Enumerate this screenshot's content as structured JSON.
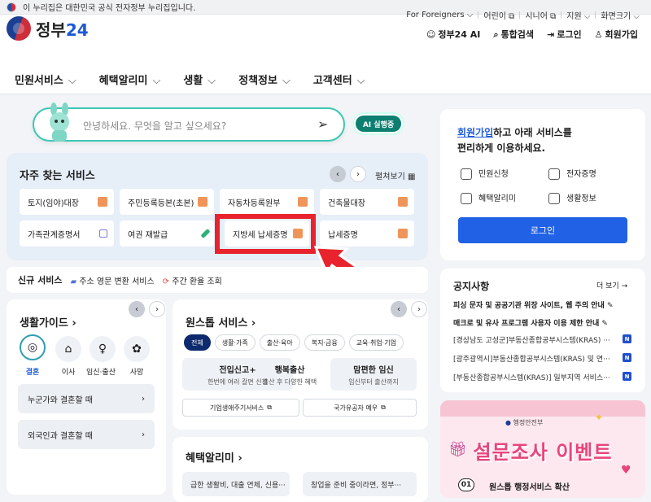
{
  "gov_banner": {
    "text": "이 누리집은 대한민국 공식 전자정부 누리집입니다."
  },
  "logo": {
    "text_main": "정부",
    "text_num": "24"
  },
  "util_links": [
    "For Foreigners",
    "어린이",
    "시니어",
    "지원",
    "화면크기"
  ],
  "util_actions": {
    "ai": "정부24 AI",
    "search": "통합검색",
    "login": "로그인",
    "signup": "회원가입"
  },
  "nav": [
    "민원서비스",
    "혜택알리미",
    "생활",
    "정책정보",
    "고객센터"
  ],
  "search": {
    "placeholder": "안녕하세요. 무엇을 알고 싶으세요?",
    "ai_badge": "AI 실행중"
  },
  "frequent": {
    "title": "자주 찾는 서비스",
    "expand": "펼쳐보기",
    "row1": [
      "토지(임야)대장",
      "주민등록등본(초본)",
      "자동차등록원부",
      "건축물대장"
    ],
    "row2": [
      "가족관계증명서",
      "여권 재발급",
      "지방세 납세증명",
      "납세증명"
    ]
  },
  "new_service": {
    "title": "신규 서비스",
    "items": [
      "주소 영문 변환 서비스",
      "주간 환율 조회"
    ]
  },
  "life_guide": {
    "title": "생활가이드",
    "categories": [
      "결혼",
      "이사",
      "임신·출산",
      "사망"
    ],
    "rows": [
      "누군가와 결혼할 때",
      "외국인과 결혼할 때"
    ]
  },
  "one_stop": {
    "title": "원스톱 서비스",
    "chips": [
      "전체",
      "생활·가족",
      "출산·육아",
      "복지·금융",
      "교육·취업·기업"
    ],
    "items": [
      {
        "title": "전입신고+",
        "sub": "한번에 여러 갈면 신청"
      },
      {
        "title": "행복출산",
        "sub": "출산 후 다양한 혜택"
      },
      {
        "title": "맘편한 임신",
        "sub": "임신부터 출산까지"
      }
    ],
    "links": [
      "기업생애주기서비스",
      "국가유공자 예우"
    ]
  },
  "benefit": {
    "title": "혜택알리미",
    "rows": [
      "급한 생활비, 대출 연체, 신용···",
      "창업을 준비 중이라면, 정부···"
    ]
  },
  "join_box": {
    "link": "회원가입",
    "rest1": "하고 아래 서비스를",
    "line2": "편리하게 이용하세요.",
    "items": [
      "민원신청",
      "전자증명",
      "혜택알리미",
      "생활정보"
    ],
    "login_button": "로그인"
  },
  "notice": {
    "title": "공지사항",
    "more": "더 보기",
    "items": [
      "피싱 문자 및 공공기관 위장 사이트, 웹 주의 안내",
      "매크로 및 유사 프로그램 사용자 이용 제한 안내",
      "[경상남도 고성군]부동산종합공부시스템(KRAS) ···",
      "[광주광역시]부동산종합공부시스템(KRAS) 및 연···",
      "[부동산종합공부시스템(KRAS)] 일부지역 서비스···"
    ]
  },
  "promo": {
    "org": "행정안전부",
    "headline": "설문조사 이벤트",
    "num": "01",
    "sub": "원스톱 행정서비스 확산"
  },
  "colors": {
    "accent": "#1e5ad6",
    "highlight": "#e8232d",
    "teal": "#0c7f70"
  }
}
